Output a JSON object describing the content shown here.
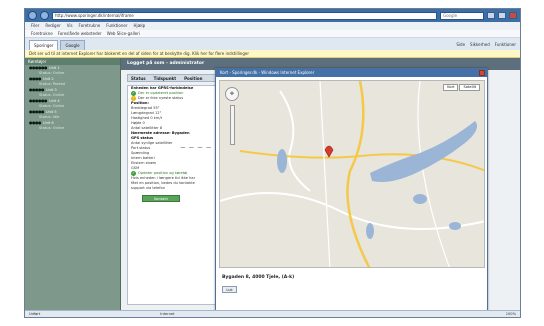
{
  "browser": {
    "address": "http://www.sporinger.dk/internal/iframe",
    "search_placeholder": "Google",
    "menu": [
      "Filer",
      "Rediger",
      "Vis",
      "Foretrukne",
      "Funktioner",
      "Hjælp"
    ],
    "favorites": [
      "Foretrukne",
      "Foreslåede websteder",
      "Web Slice-galleri"
    ],
    "tabs": [
      "Sporinger",
      "Google"
    ],
    "tab_tools": [
      "Side",
      "Sikkerhed",
      "Funktioner"
    ],
    "infobar": "Det ser ud til at internet Explorer har blokeret en del af siden for at beskytte dig. Klik her for flere indstillinger"
  },
  "sidebar": {
    "header": "Køretøjer",
    "units": [
      {
        "dots": "●●●●●●",
        "name": "Unit 1",
        "sub": "Status: Online"
      },
      {
        "dots": "●●●●",
        "name": "Unit 2",
        "sub": "Status: Parked"
      },
      {
        "dots": "●●●●●",
        "name": "Unit 3",
        "sub": "Status: Online"
      },
      {
        "dots": "●●●●●●",
        "name": "Unit 4",
        "sub": "Status: Online"
      },
      {
        "dots": "●●●●●",
        "name": "Unit 5",
        "sub": "Status: Idle"
      },
      {
        "dots": "●●●●",
        "name": "Unit 6",
        "sub": "Status: Online"
      }
    ]
  },
  "main": {
    "header": "Logget på som - administrator",
    "columns": [
      "Status",
      "Tidspunkt",
      "Position"
    ],
    "panel_lines": [
      {
        "text": "Enheden har GPRS-forbindelse",
        "kind": "bold"
      },
      {
        "text": "Der er opdateret position",
        "kind": "ok"
      },
      {
        "text": "",
        "kind": "blank"
      },
      {
        "text": "Der er ikke nyeste status",
        "kind": "warn"
      },
      {
        "text": "Position:",
        "kind": "bold"
      },
      {
        "text": "Breddegrad  55°",
        "kind": "normal"
      },
      {
        "text": "Længdegrad  12°",
        "kind": "normal"
      },
      {
        "text": "Hastighed  0 km/t",
        "kind": "normal"
      },
      {
        "text": "Højde  0",
        "kind": "normal"
      },
      {
        "text": "Antal satellitter  8",
        "kind": "normal"
      },
      {
        "text": "Nærmeste adresse: Bygaden",
        "kind": "bold"
      },
      {
        "text": "",
        "kind": "blank"
      },
      {
        "text": "GPS status",
        "kind": "bold"
      },
      {
        "text": "Antal synlige satellitter",
        "kind": "normal"
      },
      {
        "text": "Port status",
        "kind": "dashes"
      },
      {
        "text": "Spænding",
        "kind": "normal"
      },
      {
        "text": "Intern batteri",
        "kind": "normal"
      },
      {
        "text": "Ekstern strøm",
        "kind": "normal"
      },
      {
        "text": "GSM",
        "kind": "normal"
      },
      {
        "text": "Opdater position og køretøj",
        "kind": "ok"
      },
      {
        "text": "",
        "kind": "blank"
      },
      {
        "text": "Hvis enheden i længere tid ikke har",
        "kind": "normal"
      },
      {
        "text": "fået en position, bedes du kontakte",
        "kind": "normal"
      },
      {
        "text": "support via telefon",
        "kind": "normal"
      }
    ],
    "button": "Kontakt"
  },
  "popup": {
    "title": "Kort - Sporinger.dk - Windows Internet Explorer",
    "map_toggle": [
      "Kort",
      "Satellit"
    ],
    "address": "Bygaden 8, 4000 Tjele, (A-k)",
    "close_button": "Luk"
  },
  "statusbar": {
    "left": "Udført",
    "zone": "Internet",
    "zoom": "100%"
  },
  "colors": {
    "sidebar_bg": "#7e998b",
    "titlebar": "#3d6ea5",
    "map_water": "#9ab5d6",
    "map_road": "#f4c94a",
    "marker": "#d93c2d"
  }
}
